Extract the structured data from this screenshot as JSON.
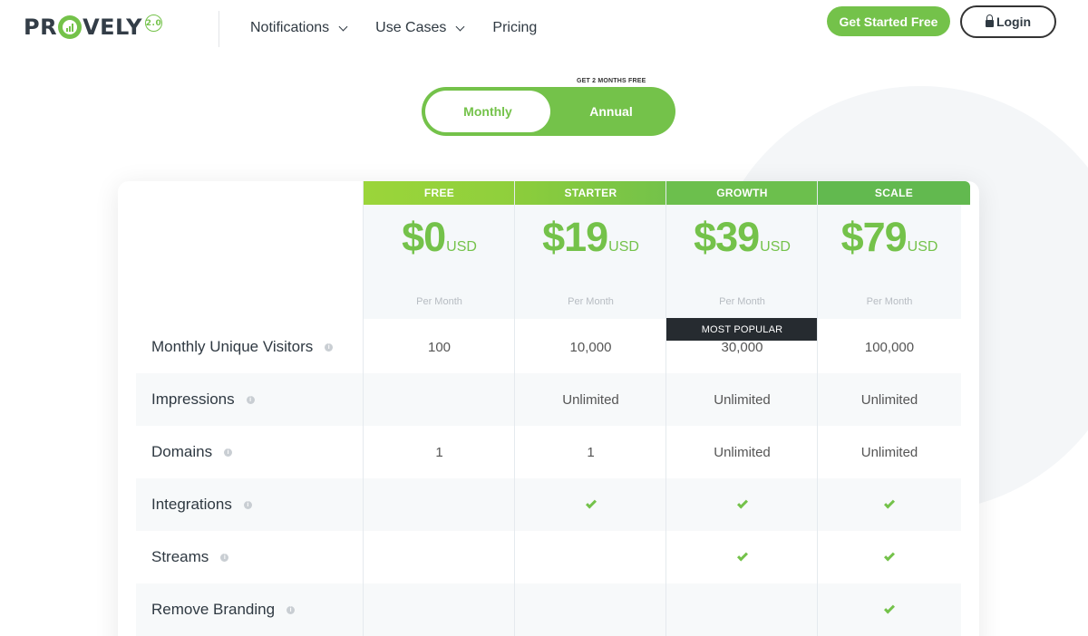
{
  "header": {
    "logo": {
      "pre": "PR",
      "post": "VELY",
      "version": "2.0"
    },
    "nav": [
      {
        "label": "Notifications"
      },
      {
        "label": "Use Cases"
      },
      {
        "label": "Pricing"
      }
    ],
    "cta_label": "Get Started Free",
    "login_label": "Login"
  },
  "billing": {
    "promo": "GET 2 MONTHS FREE",
    "monthly_label": "Monthly",
    "annual_label": "Annual",
    "selected": "Monthly"
  },
  "plans": [
    {
      "name": "FREE",
      "price": "$0",
      "currency": "USD",
      "period": "Per Month",
      "header_color": "#8fcf3c"
    },
    {
      "name": "STARTER",
      "price": "$19",
      "currency": "USD",
      "period": "Per Month",
      "header_color": "#84c93f"
    },
    {
      "name": "GROWTH",
      "price": "$39",
      "currency": "USD",
      "period": "Per Month",
      "badge": "MOST POPULAR",
      "header_color": "#6cbf4d"
    },
    {
      "name": "SCALE",
      "price": "$79",
      "currency": "USD",
      "period": "Per Month",
      "header_color": "#62b94f"
    }
  ],
  "features": [
    {
      "label": "Monthly Unique Visitors",
      "values": [
        "100",
        "10,000",
        "30,000",
        "100,000"
      ]
    },
    {
      "label": "Impressions",
      "values": [
        "",
        "Unlimited",
        "Unlimited",
        "Unlimited"
      ]
    },
    {
      "label": "Domains",
      "values": [
        "1",
        "1",
        "Unlimited",
        "Unlimited"
      ]
    },
    {
      "label": "Integrations",
      "values": [
        "",
        "✓",
        "✓",
        "✓"
      ]
    },
    {
      "label": "Streams",
      "values": [
        "",
        "",
        "✓",
        "✓"
      ]
    },
    {
      "label": "Remove Branding",
      "values": [
        "",
        "",
        "",
        "✓"
      ]
    }
  ],
  "colors": {
    "accent": "#74c24a",
    "dark": "#2f3942",
    "badge": "#262b30"
  }
}
